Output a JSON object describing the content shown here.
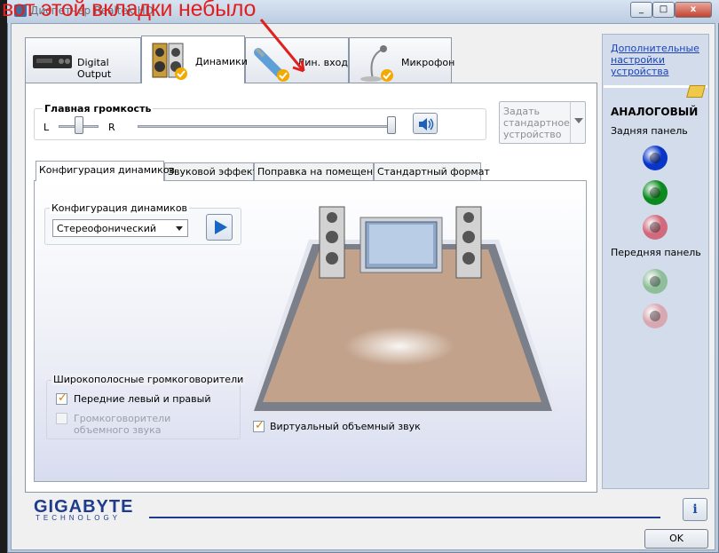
{
  "window": {
    "title": "Диспетчер Realtek HD",
    "close_glyph": "x",
    "min_glyph": "_",
    "max_glyph": "□"
  },
  "annotation": {
    "text": "вот этой вкладки небыло",
    "color": "#e0201f"
  },
  "tabs": [
    {
      "label": "Digital Output"
    },
    {
      "label": "Динамики",
      "selected": true
    },
    {
      "label": "Лин. вход"
    },
    {
      "label": "Микрофон"
    }
  ],
  "volume": {
    "group_label": "Главная громкость",
    "left_label": "L",
    "right_label": "R",
    "balance_level": 0.5,
    "master_level": 1.0
  },
  "set_default": {
    "label": "Задать стандартное устройство",
    "enabled": false
  },
  "subtabs": [
    {
      "label": "Конфигурация динамиков",
      "selected": true
    },
    {
      "label": "Звуковой эффект"
    },
    {
      "label": "Поправка на помещение"
    },
    {
      "label": "Стандартный формат"
    }
  ],
  "speaker_config": {
    "group_label": "Конфигурация динамиков",
    "selected_value": "Стереофонический"
  },
  "fullrange": {
    "group_label": "Широкополосные громкоговорители",
    "front_label": "Передние левый и правый",
    "front_checked": true,
    "surround_label": "Громкоговорители объемного звука",
    "surround_checked": false,
    "surround_enabled": false
  },
  "virtual_surround": {
    "label": "Виртуальный объемный звук",
    "checked": true
  },
  "right_panel": {
    "advanced_link": "Дополнительные настройки устройства",
    "analog_title": "АНАЛОГОВЫЙ",
    "rear_label": "Задняя панель",
    "front_label": "Передняя панель",
    "rear_jacks": [
      "#0a36c8",
      "#0b8a1f",
      "#d06a7c"
    ],
    "front_jacks": [
      "#8fbf9a",
      "#d7a8b2"
    ]
  },
  "brand": {
    "name": "GIGABYTE",
    "sub": "TECHNOLOGY",
    "color": "#1f3c8c"
  },
  "buttons": {
    "ok": "OK",
    "info_glyph": "i"
  }
}
